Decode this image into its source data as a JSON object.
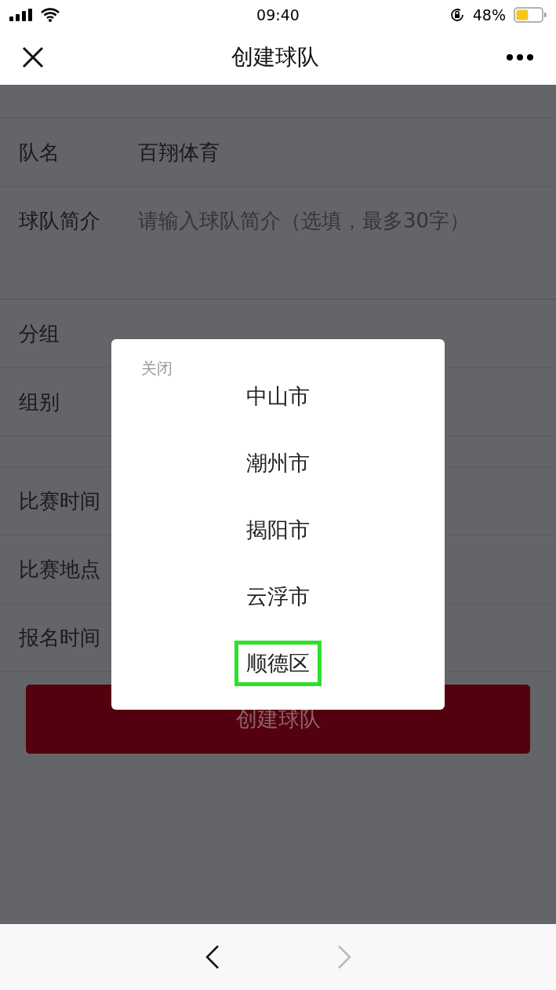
{
  "status_bar": {
    "time": "09:40",
    "battery": "48%"
  },
  "nav": {
    "title": "创建球队"
  },
  "form": {
    "sections": [
      [
        {
          "label": "队名",
          "value": "百翔体育"
        },
        {
          "label": "球队简介",
          "placeholder": "请输入球队简介（选填，最多30字）"
        }
      ],
      [
        {
          "label": "分组"
        },
        {
          "label": "组别"
        }
      ],
      [
        {
          "label": "比赛时间"
        },
        {
          "label": "比赛地点"
        },
        {
          "label": "报名时间"
        }
      ]
    ]
  },
  "submit_button": {
    "label": "创建球队"
  },
  "popup": {
    "close_label": "关闭",
    "options": [
      {
        "label": "中山市",
        "selected": false
      },
      {
        "label": "潮州市",
        "selected": false
      },
      {
        "label": "揭阳市",
        "selected": false
      },
      {
        "label": "云浮市",
        "selected": false
      },
      {
        "label": "顺德区",
        "selected": true
      }
    ]
  },
  "bottom_bar": {
    "back_disabled": false,
    "forward_disabled": true
  }
}
